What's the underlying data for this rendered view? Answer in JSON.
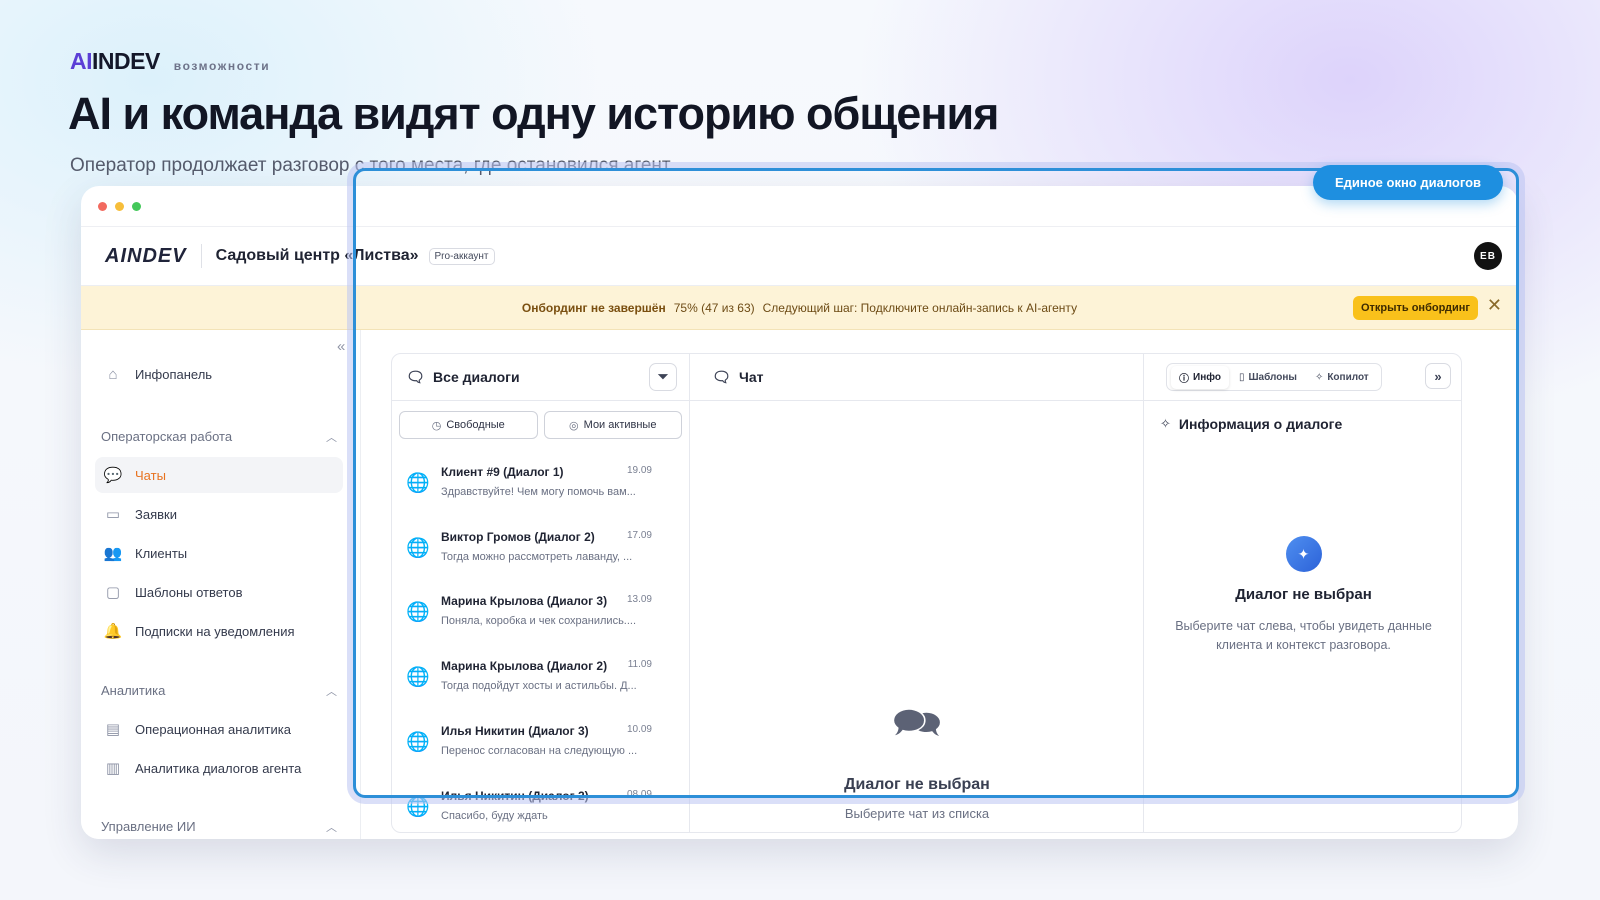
{
  "slide": {
    "brand_ai": "AI",
    "brand_rest": "INDEV",
    "brand_tag": "возможности",
    "headline": "AI и команда видят одну историю общения",
    "subhead": "Оператор продолжает разговор с того места, где остановился агент",
    "callout": "Единое окно диалогов"
  },
  "app": {
    "logo": "AINDEV",
    "org_name": "Садовый центр «Листва»",
    "plan_badge": "Pro-аккаунт",
    "avatar_initials": "EB"
  },
  "onboarding": {
    "title": "Онбординг не завершён",
    "progress": "75% (47 из 63)",
    "next_step": "Следующий шаг: Подключите онлайн-запись к AI-агенту",
    "button": "Открыть онбординг"
  },
  "sidebar": {
    "home": "Инфопанель",
    "group_operator": "Операторская работа",
    "items_operator": [
      "Чаты",
      "Заявки",
      "Клиенты",
      "Шаблоны ответов",
      "Подписки на уведомления"
    ],
    "group_analytics": "Аналитика",
    "items_analytics": [
      "Операционная аналитика",
      "Аналитика диалогов агента"
    ],
    "group_ai": "Управление ИИ"
  },
  "dialogs": {
    "title": "Все диалоги",
    "filters": [
      "Свободные",
      "Мои активные"
    ],
    "items": [
      {
        "name": "Клиент #9 (Диалог 1)",
        "date": "19.09",
        "preview": "Здравствуйте! Чем могу помочь вам..."
      },
      {
        "name": "Виктор Громов (Диалог 2)",
        "date": "17.09",
        "preview": "Тогда можно рассмотреть лаванду, ..."
      },
      {
        "name": "Марина Крылова (Диалог 3)",
        "date": "13.09",
        "preview": "Поняла, коробка и чек сохранились...."
      },
      {
        "name": "Марина Крылова (Диалог 2)",
        "date": "11.09",
        "preview": "Тогда подойдут хосты и астильбы. Д..."
      },
      {
        "name": "Илья Никитин (Диалог 3)",
        "date": "10.09",
        "preview": "Перенос согласован на следующую ..."
      },
      {
        "name": "Илья Никитин (Диалог 2)",
        "date": "08.09",
        "preview": "Спасибо, буду ждать"
      }
    ]
  },
  "chat": {
    "title": "Чат",
    "empty_title": "Диалог не выбран",
    "empty_sub": "Выберите чат из списка"
  },
  "info": {
    "tabs": [
      "Инфо",
      "Шаблоны",
      "Копилот"
    ],
    "title": "Информация о диалоге",
    "empty_title": "Диалог не выбран",
    "empty_sub": "Выберите чат слева, чтобы увидеть данные клиента и контекст разговора."
  },
  "colors": {
    "accent": "#e8721f",
    "highlight": "#2d8fd8",
    "banner_bg": "#fdf3d7",
    "button_yellow": "#f9c11b"
  }
}
